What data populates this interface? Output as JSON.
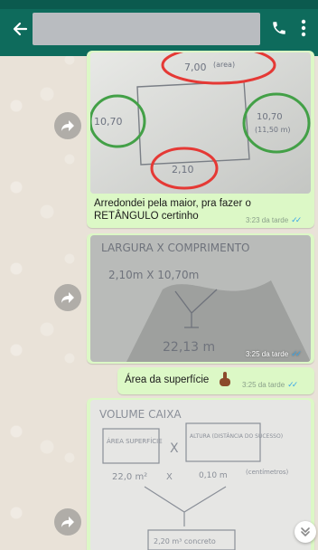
{
  "header": {
    "contact_name": "",
    "back_icon": "arrow-left-icon",
    "call_icon": "phone-icon",
    "menu_icon": "vertical-dots-icon",
    "background": "#0e6b5c"
  },
  "messages": [
    {
      "type": "image",
      "image_desc_icon": "handwritten-rectangle-sketch",
      "sketch_texts": [
        "7,00",
        "(area)",
        "10,70",
        "10,70",
        "(11,50 m)",
        "2,10"
      ],
      "caption_line1": "Arredondei pela maior, pra fazer o",
      "caption_line2": "RETÂNGULO certinho",
      "time": "3:23 da tarde",
      "status": "read"
    },
    {
      "type": "image",
      "image_desc_icon": "handwritten-calculation",
      "sketch_texts": [
        "LARGURA X COMPRIMENTO",
        "2,10m  X  10,70m",
        "22,13 m"
      ],
      "time": "3:25 da tarde",
      "status": "read"
    },
    {
      "type": "text",
      "text": "Área da superfície",
      "emoji_icon": "pointing-finger-emoji",
      "time": "3:25 da tarde",
      "status": "read"
    },
    {
      "type": "image",
      "image_desc_icon": "handwritten-volume-sketch",
      "sketch_texts": [
        "VOLUME CAIXA",
        "ÁREA SUPERFÍCIE",
        "X",
        "ALTURA (DISTÂNCIA DO SUCESSO)",
        "22,0 m²",
        "X",
        "0,10 m",
        "(centímetros)",
        "2,20 m³ concreto"
      ],
      "status": "read"
    }
  ],
  "controls": {
    "forward_icon": "forward-arrow-icon",
    "scroll_down_icon": "double-chevron-down-icon"
  },
  "colors": {
    "bubble_out": "#dcf8c6",
    "read_ticks": "#3aa7e8",
    "chat_bg": "#e9e2d8",
    "red_circle": "#e53935",
    "green_circle": "#43a047"
  }
}
